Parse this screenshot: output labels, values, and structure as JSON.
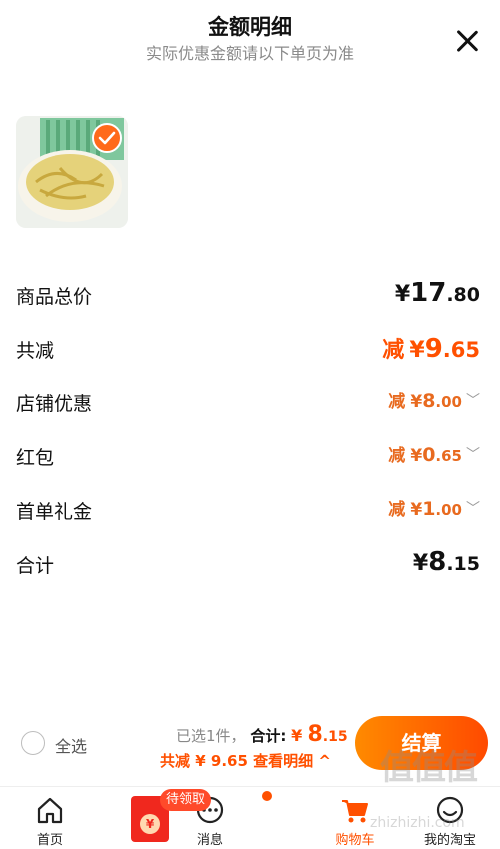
{
  "header": {
    "title": "金额明细",
    "subtitle": "实际优惠金额请以下单页为准"
  },
  "rows": {
    "total_price": {
      "label": "商品总价",
      "currency": "¥",
      "int": "17",
      "dec": ".80"
    },
    "total_discount": {
      "label": "共减",
      "prefix": "减",
      "currency": "¥",
      "int": "9",
      "dec": ".65"
    },
    "store_coupon": {
      "label": "店铺优惠",
      "prefix": "减",
      "currency": "¥",
      "int": "8",
      "dec": ".00"
    },
    "red_packet": {
      "label": "红包",
      "prefix": "减",
      "currency": "¥",
      "int": "0",
      "dec": ".65"
    },
    "first_order": {
      "label": "首单礼金",
      "prefix": "减",
      "currency": "¥",
      "int": "1",
      "dec": ".00"
    },
    "subtotal": {
      "label": "合计",
      "currency": "¥",
      "int": "8",
      "dec": ".15"
    }
  },
  "bottom": {
    "select_all": "全选",
    "selected_text": "已选1件，",
    "sum_label": "合计:",
    "sum_currency": "¥",
    "sum_int": "8",
    "sum_dec": ".15",
    "reduced_text": "共减 ¥ 9.65 查看明细 ^",
    "checkout": "结算"
  },
  "tabs": [
    {
      "label": "首页",
      "icon": "home-icon"
    },
    {
      "label": "",
      "icon": "red-packet-icon",
      "badge": "待领取"
    },
    {
      "label": "消息",
      "icon": "message-icon"
    },
    {
      "label": "购物车",
      "icon": "cart-icon"
    },
    {
      "label": "我的淘宝",
      "icon": "profile-icon"
    }
  ],
  "watermark": {
    "main": "值值值",
    "sub": "zhizhizhi.com"
  },
  "colors": {
    "accent": "#ff5000",
    "discount": "#e86a1f",
    "checkout_start": "#ff8a00",
    "checkout_end": "#ff4a00"
  }
}
